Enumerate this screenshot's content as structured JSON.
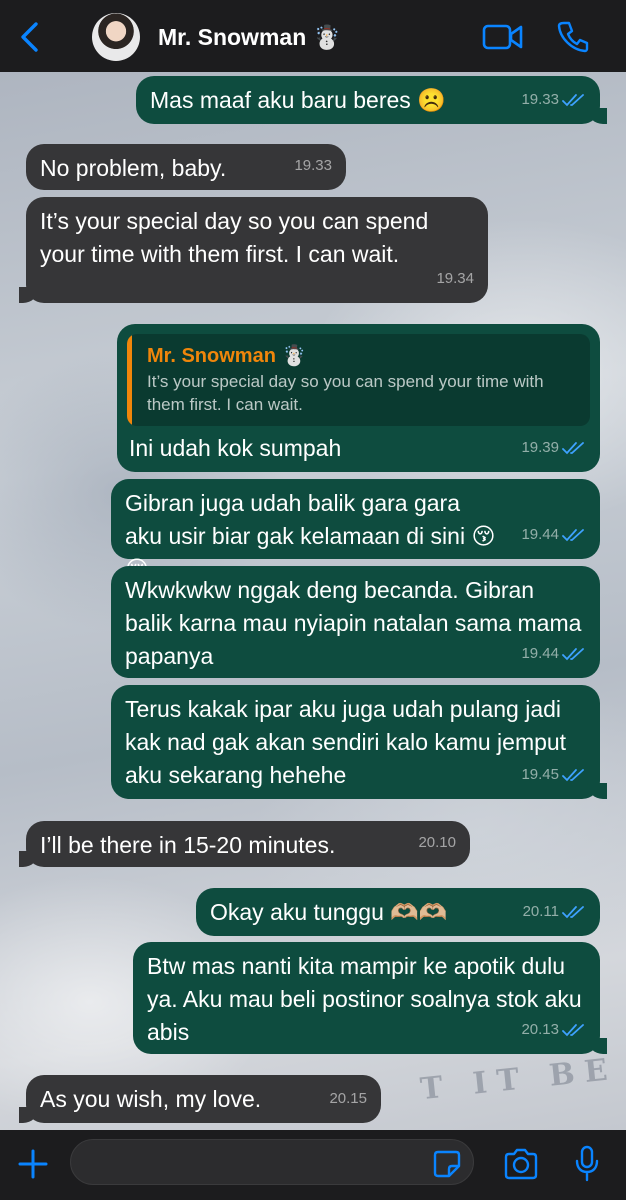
{
  "header": {
    "contact_name": "Mr. Snowman ☃️"
  },
  "wallpaper": {
    "text": "T IT BE"
  },
  "messages": [
    {
      "dir": "out",
      "text": "Mas maaf aku baru beres ☹️",
      "time": "19.33",
      "read": true
    },
    {
      "dir": "in",
      "text": "No problem, baby.",
      "time": "19.33"
    },
    {
      "dir": "in",
      "text": "It’s your special day so you can spend your time with them first. I can wait.",
      "time": "19.34"
    },
    {
      "dir": "out",
      "reply_to": {
        "name": "Mr. Snowman ☃️",
        "text": "It’s your special day so you can spend your time with them first. I can wait."
      },
      "text": "Ini udah kok sumpah",
      "time": "19.39",
      "read": true
    },
    {
      "dir": "out",
      "text": "Gibran juga udah balik gara gara aku usir biar gak kelamaan di sini 😚😚",
      "time": "19.44",
      "read": true
    },
    {
      "dir": "out",
      "text": "Wkwkwkw nggak deng becanda. Gibran balik karna mau nyiapin natalan sama mama papanya",
      "time": "19.44",
      "read": true
    },
    {
      "dir": "out",
      "text": "Terus kakak ipar aku juga udah pulang jadi kak nad gak akan sendiri kalo kamu jemput aku sekarang hehehe",
      "time": "19.45",
      "read": true
    },
    {
      "dir": "in",
      "text": "I’ll be there in 15-20 minutes.",
      "time": "20.10"
    },
    {
      "dir": "out",
      "text": "Okay aku tunggu 🫶🏼🫶🏼",
      "time": "20.11",
      "read": true
    },
    {
      "dir": "out",
      "text": "Btw mas nanti kita mampir ke apotik dulu ya. Aku mau beli postinor soalnya stok aku abis",
      "time": "20.13",
      "read": true
    },
    {
      "dir": "in",
      "text": "As you wish, my love.",
      "time": "20.15"
    }
  ],
  "input": {
    "value": "",
    "placeholder": ""
  },
  "icons": {
    "back": "chevron-left-icon",
    "video": "video-camera-icon",
    "call": "phone-icon",
    "plus": "plus-icon",
    "sticker": "sticker-icon",
    "camera": "camera-icon",
    "mic": "microphone-icon"
  },
  "colors": {
    "accent": "#0a84ff",
    "incoming_bubble": "#363638",
    "outgoing_bubble": "#0e4c3f",
    "reply_name": "#f0860b",
    "bar_background": "#1c1c1e"
  }
}
